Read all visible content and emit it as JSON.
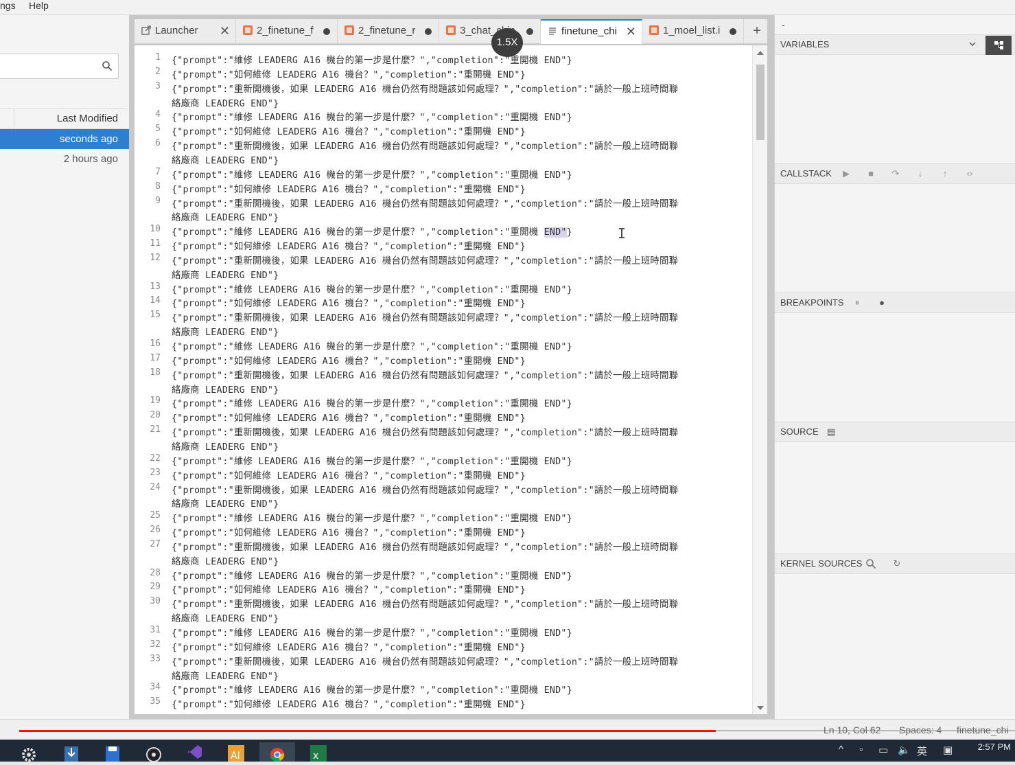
{
  "menubar": {
    "settings_partial": "ngs",
    "help": "Help"
  },
  "file_browser": {
    "search_placeholder": "",
    "column_header": "Last Modified",
    "rows": [
      {
        "modified": "seconds ago",
        "selected": true
      },
      {
        "modified": "2 hours ago",
        "selected": false
      }
    ]
  },
  "tabs": [
    {
      "label": "Launcher",
      "kind": "launcher",
      "state": "close"
    },
    {
      "label": "2_finetune_f",
      "kind": "notebook",
      "state": "dirty"
    },
    {
      "label": "2_finetune_r",
      "kind": "notebook",
      "state": "dirty"
    },
    {
      "label": "3_chat_chin",
      "kind": "notebook",
      "state": "dirty"
    },
    {
      "label": "finetune_chi",
      "kind": "text",
      "state": "close",
      "active": true
    },
    {
      "label": "1_moel_list.i",
      "kind": "notebook",
      "state": "dirty"
    }
  ],
  "zoom_badge": "1.5X",
  "editor": {
    "line_numbers": [
      "1",
      "2",
      "3",
      "",
      "4",
      "5",
      "6",
      "",
      "7",
      "8",
      "9",
      "",
      "10",
      "11",
      "12",
      "",
      "13",
      "14",
      "15",
      "",
      "16",
      "17",
      "18",
      "",
      "19",
      "20",
      "21",
      "",
      "22",
      "23",
      "24",
      "",
      "25",
      "26",
      "27",
      "",
      "28",
      "29",
      "30",
      "",
      "31",
      "32",
      "33",
      "",
      "34",
      "35"
    ],
    "lines": [
      "{\"prompt\":\"維修 LEADERG A16 機台的第一步是什麼？\",\"completion\":\"重開機 END\"}",
      "{\"prompt\":\"如何維修 LEADERG A16 機台？\",\"completion\":\"重開機 END\"}",
      "{\"prompt\":\"重新開機後，如果 LEADERG A16 機台仍然有問題該如何處理？\",\"completion\":\"請於一般上班時間聯",
      "絡廠商 LEADERG END\"}",
      "{\"prompt\":\"維修 LEADERG A16 機台的第一步是什麼？\",\"completion\":\"重開機 END\"}",
      "{\"prompt\":\"如何維修 LEADERG A16 機台？\",\"completion\":\"重開機 END\"}",
      "{\"prompt\":\"重新開機後，如果 LEADERG A16 機台仍然有問題該如何處理？\",\"completion\":\"請於一般上班時間聯",
      "絡廠商 LEADERG END\"}",
      "{\"prompt\":\"維修 LEADERG A16 機台的第一步是什麼？\",\"completion\":\"重開機 END\"}",
      "{\"prompt\":\"如何維修 LEADERG A16 機台？\",\"completion\":\"重開機 END\"}",
      "{\"prompt\":\"重新開機後，如果 LEADERG A16 機台仍然有問題該如何處理？\",\"completion\":\"請於一般上班時間聯",
      "絡廠商 LEADERG END\"}",
      "{\"prompt\":\"維修 LEADERG A16 機台的第一步是什麼？\",\"completion\":\"重開機 END\"}",
      "{\"prompt\":\"如何維修 LEADERG A16 機台？\",\"completion\":\"重開機 END\"}",
      "{\"prompt\":\"重新開機後，如果 LEADERG A16 機台仍然有問題該如何處理？\",\"completion\":\"請於一般上班時間聯",
      "絡廠商 LEADERG END\"}",
      "{\"prompt\":\"維修 LEADERG A16 機台的第一步是什麼？\",\"completion\":\"重開機 END\"}",
      "{\"prompt\":\"如何維修 LEADERG A16 機台？\",\"completion\":\"重開機 END\"}",
      "{\"prompt\":\"重新開機後，如果 LEADERG A16 機台仍然有問題該如何處理？\",\"completion\":\"請於一般上班時間聯",
      "絡廠商 LEADERG END\"}",
      "{\"prompt\":\"維修 LEADERG A16 機台的第一步是什麼？\",\"completion\":\"重開機 END\"}",
      "{\"prompt\":\"如何維修 LEADERG A16 機台？\",\"completion\":\"重開機 END\"}",
      "{\"prompt\":\"重新開機後，如果 LEADERG A16 機台仍然有問題該如何處理？\",\"completion\":\"請於一般上班時間聯",
      "絡廠商 LEADERG END\"}",
      "{\"prompt\":\"維修 LEADERG A16 機台的第一步是什麼？\",\"completion\":\"重開機 END\"}",
      "{\"prompt\":\"如何維修 LEADERG A16 機台？\",\"completion\":\"重開機 END\"}",
      "{\"prompt\":\"重新開機後，如果 LEADERG A16 機台仍然有問題該如何處理？\",\"completion\":\"請於一般上班時間聯",
      "絡廠商 LEADERG END\"}",
      "{\"prompt\":\"維修 LEADERG A16 機台的第一步是什麼？\",\"completion\":\"重開機 END\"}",
      "{\"prompt\":\"如何維修 LEADERG A16 機台？\",\"completion\":\"重開機 END\"}",
      "{\"prompt\":\"重新開機後，如果 LEADERG A16 機台仍然有問題該如何處理？\",\"completion\":\"請於一般上班時間聯",
      "絡廠商 LEADERG END\"}",
      "{\"prompt\":\"維修 LEADERG A16 機台的第一步是什麼？\",\"completion\":\"重開機 END\"}",
      "{\"prompt\":\"如何維修 LEADERG A16 機台？\",\"completion\":\"重開機 END\"}",
      "{\"prompt\":\"重新開機後，如果 LEADERG A16 機台仍然有問題該如何處理？\",\"completion\":\"請於一般上班時間聯",
      "絡廠商 LEADERG END\"}",
      "{\"prompt\":\"維修 LEADERG A16 機台的第一步是什麼？\",\"completion\":\"重開機 END\"}",
      "{\"prompt\":\"如何維修 LEADERG A16 機台？\",\"completion\":\"重開機 END\"}",
      "{\"prompt\":\"重新開機後，如果 LEADERG A16 機台仍然有問題該如何處理？\",\"completion\":\"請於一般上班時間聯",
      "絡廠商 LEADERG END\"}",
      "{\"prompt\":\"維修 LEADERG A16 機台的第一步是什麼？\",\"completion\":\"重開機 END\"}",
      "{\"prompt\":\"如何維修 LEADERG A16 機台？\",\"completion\":\"重開機 END\"}",
      "{\"prompt\":\"重新開機後，如果 LEADERG A16 機台仍然有問題該如何處理？\",\"completion\":\"請於一般上班時間聯",
      "絡廠商 LEADERG END\"}",
      "{\"prompt\":\"維修 LEADERG A16 機台的第一步是什麼？\",\"completion\":\"重開機 END\"}",
      "{\"prompt\":\"如何維修 LEADERG A16 機台？\",\"completion\":\"重開機 END\"}"
    ],
    "highlight_line_number": "10",
    "highlight_text": "END\""
  },
  "debugger": {
    "top_label": "-",
    "sections": [
      "VARIABLES",
      "CALLSTACK",
      "BREAKPOINTS",
      "SOURCE",
      "KERNEL SOURCES"
    ]
  },
  "statusbar": {
    "position": "Ln 10, Col 62",
    "spaces": "Spaces: 4",
    "filename": "finetune_chi"
  },
  "taskbar": {
    "apps": [
      "settings-icon",
      "downloader-icon",
      "save-disk-icon",
      "obs-icon",
      "visual-studio-icon",
      "illustrator-icon",
      "chrome-icon",
      "excel-icon"
    ],
    "ime": "英",
    "time": "2:57 PM"
  },
  "colors": {
    "accent": "#2f7fd1",
    "progress": "#ee1111",
    "taskbar": "#1f2a36"
  }
}
